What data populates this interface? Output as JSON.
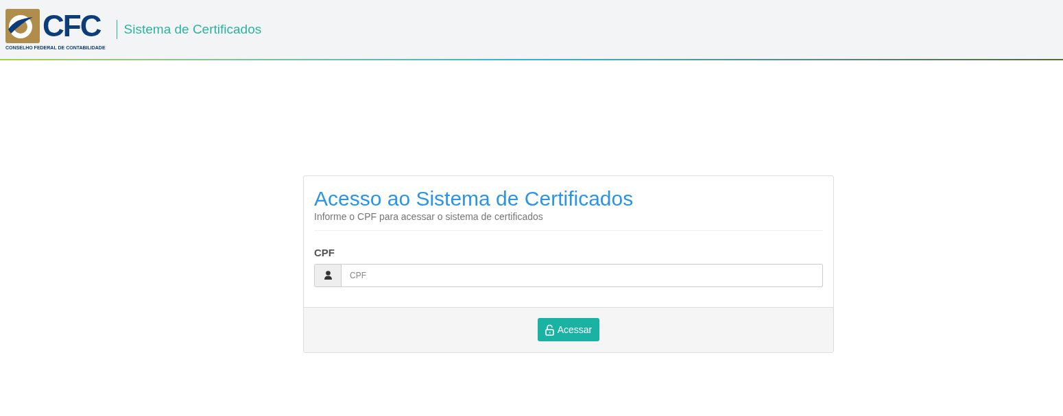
{
  "header": {
    "logo_text": "CFC",
    "logo_caption": "CONSELHO FEDERAL DE CONTABILIDADE",
    "title": "Sistema de Certificados"
  },
  "login": {
    "title": "Acesso ao Sistema de Certificados",
    "subtitle": "Informe o CPF para acessar o sistema de certificados",
    "field_label": "CPF",
    "placeholder": "CPF",
    "button": "Acessar"
  }
}
